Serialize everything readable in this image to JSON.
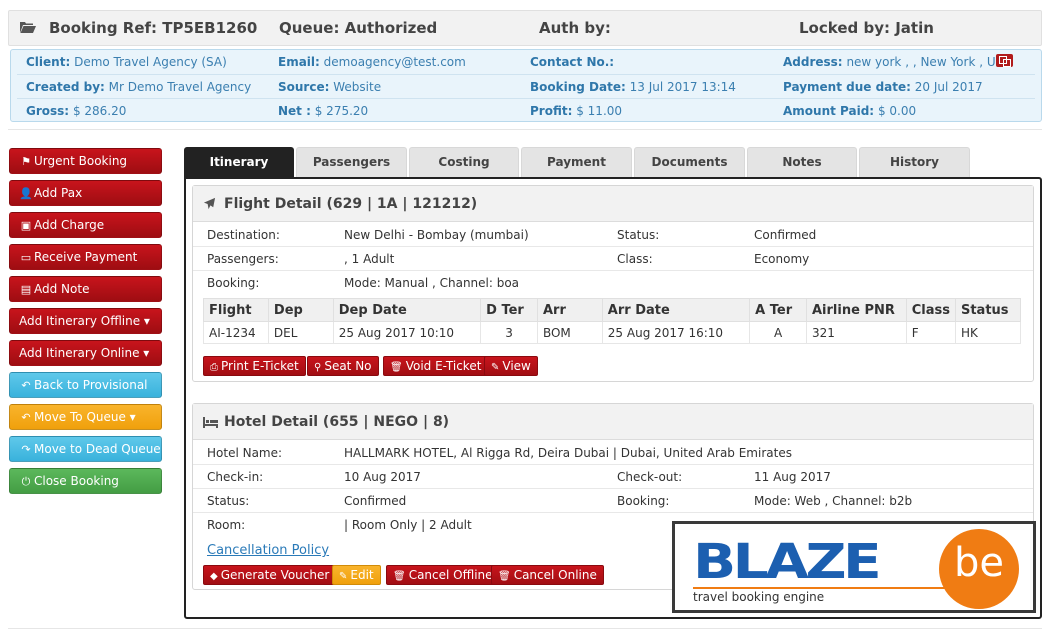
{
  "header": {
    "booking_ref": "Booking Ref: TP5EB1260",
    "queue": "Queue: Authorized",
    "auth_by": "Auth by:",
    "locked_by": "Locked by: Jatin"
  },
  "info": {
    "client_label": "Client:",
    "client": "Demo Travel Agency (SA)",
    "email_label": "Email:",
    "email": "demoagency@test.com",
    "contact_label": "Contact No.:",
    "contact": "",
    "address_label": "Address:",
    "address": "new york , , New York , USA",
    "created_label": "Created by:",
    "created": "Mr Demo Travel Agency",
    "source_label": "Source:",
    "source": "Website",
    "booking_date_label": "Booking Date:",
    "booking_date": "13 Jul 2017 13:14",
    "payment_due_label": "Payment due date:",
    "payment_due": "20 Jul 2017",
    "gross_label": "Gross:",
    "gross": "$ 286.20",
    "net_label": "Net :",
    "net": "$ 275.20",
    "profit_label": "Profit:",
    "profit": "$ 11.00",
    "paid_label": "Amount Paid:",
    "paid": "$ 0.00"
  },
  "sidebar": [
    {
      "label": "Urgent Booking",
      "icon": "flag-icon",
      "glyph": "⚑",
      "color": "red"
    },
    {
      "label": "Add Pax",
      "icon": "user-icon",
      "glyph": "👤",
      "color": "red"
    },
    {
      "label": "Add Charge",
      "icon": "money-icon",
      "glyph": "▣",
      "color": "red"
    },
    {
      "label": "Receive Payment",
      "icon": "credit-card-icon",
      "glyph": "▭",
      "color": "red"
    },
    {
      "label": "Add Note",
      "icon": "file-icon",
      "glyph": "▤",
      "color": "red"
    },
    {
      "label": "Add Itinerary Offline ▾",
      "icon": "",
      "glyph": "",
      "color": "red"
    },
    {
      "label": "Add Itinerary Online ▾",
      "icon": "",
      "glyph": "",
      "color": "red"
    },
    {
      "label": "Back to Provisional",
      "icon": "reply-icon",
      "glyph": "↶",
      "color": "blue"
    },
    {
      "label": "Move To Queue ▾",
      "icon": "reply-icon",
      "glyph": "↶",
      "color": "orange"
    },
    {
      "label": "Move to Dead Queue",
      "icon": "share-icon",
      "glyph": "↷",
      "color": "blue"
    },
    {
      "label": "Close Booking",
      "icon": "power-icon",
      "glyph": "⏻",
      "color": "green"
    }
  ],
  "tabs": [
    "Itinerary",
    "Passengers",
    "Costing",
    "Payment",
    "Documents",
    "Notes",
    "History"
  ],
  "flight": {
    "title": "Flight Detail (629 |   1A |   121212)",
    "destination_label": "Destination:",
    "destination": "New Delhi - Bombay (mumbai)",
    "status_label": "Status:",
    "status": "Confirmed",
    "passengers_label": "Passengers:",
    "passengers": ", 1 Adult",
    "class_label": "Class:",
    "class": "Economy",
    "booking_label": "Booking:",
    "booking": "Mode: Manual , Channel: boa",
    "table": {
      "headers": [
        "Flight",
        "Dep",
        "Dep Date",
        "D Ter",
        "Arr",
        "Arr Date",
        "A Ter",
        "Airline PNR",
        "Class",
        "Status"
      ],
      "rows": [
        [
          "AI-1234",
          "DEL",
          "25 Aug 2017 10:10",
          "3",
          "BOM",
          "25 Aug 2017 16:10",
          "A",
          "321",
          "F",
          "HK"
        ]
      ]
    },
    "buttons": [
      {
        "label": "Print E-Ticket",
        "glyph": "⎙",
        "icon": "print-icon"
      },
      {
        "label": "Seat No",
        "glyph": "⚲",
        "icon": "link-icon"
      },
      {
        "label": "Void E-Ticket",
        "glyph": "🗑",
        "icon": "trash-icon"
      },
      {
        "label": "View",
        "glyph": "✎",
        "icon": "edit-icon"
      }
    ]
  },
  "hotel": {
    "title": "Hotel Detail (655 |   NEGO |   8)",
    "name_label": "Hotel Name:",
    "name": "HALLMARK HOTEL, Al Rigga Rd, Deira Dubai | Dubai, United Arab Emirates",
    "checkin_label": "Check-in:",
    "checkin": "10 Aug 2017",
    "checkout_label": "Check-out:",
    "checkout": "11 Aug 2017",
    "status_label": "Status:",
    "status": "Confirmed",
    "booking_label": "Booking:",
    "booking": "Mode: Web , Channel: b2b",
    "room_label": "Room:",
    "room": "| Room Only | 2 Adult",
    "cancellation_link": "Cancellation Policy",
    "buttons": [
      {
        "label": "Generate Voucher",
        "glyph": "◆",
        "icon": "ticket-icon"
      },
      {
        "label": "Edit",
        "glyph": "✎",
        "icon": "edit-icon"
      },
      {
        "label": "Cancel Offline",
        "glyph": "🗑",
        "icon": "trash-icon"
      },
      {
        "label": "Cancel Online",
        "glyph": "🗑",
        "icon": "trash-icon"
      }
    ]
  },
  "logo": {
    "word": "BLAZE",
    "be": "be",
    "tagline": "travel booking engine"
  }
}
